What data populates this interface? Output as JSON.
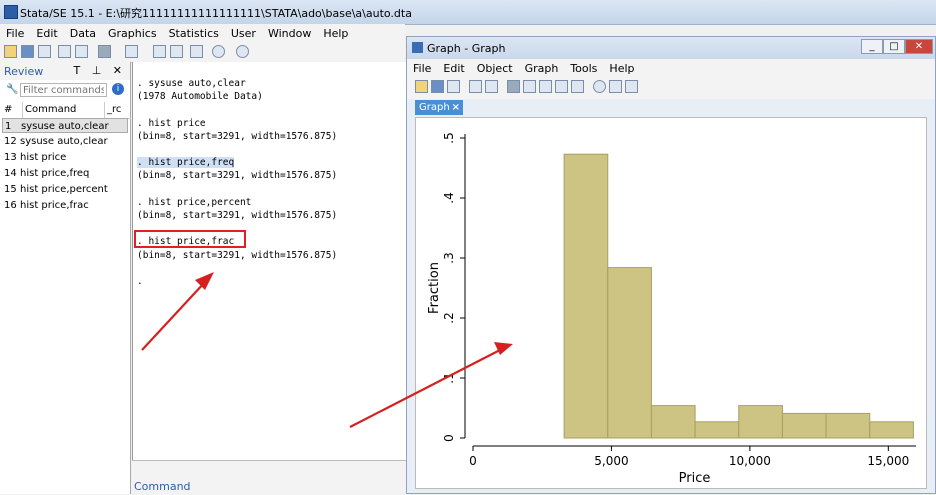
{
  "main_window": {
    "title": "Stata/SE 15.1 - E:\\研究11111111111111111\\STATA\\ado\\base\\a\\auto.dta"
  },
  "menubar": [
    "File",
    "Edit",
    "Data",
    "Graphics",
    "Statistics",
    "User",
    "Window",
    "Help"
  ],
  "review": {
    "title": "Review",
    "controls": "T ⊥ ✕",
    "filter_placeholder": "Filter commands here",
    "col_num": "#",
    "col_command": "Command",
    "col_rc": "_rc",
    "rows": [
      {
        "num": "1",
        "cmd": "sysuse auto,clear",
        "selected": true
      },
      {
        "num": "12",
        "cmd": "sysuse auto,clear",
        "selected": false
      },
      {
        "num": "13",
        "cmd": "hist price",
        "selected": false
      },
      {
        "num": "14",
        "cmd": "hist price,freq",
        "selected": false
      },
      {
        "num": "15",
        "cmd": "hist price,percent",
        "selected": false
      },
      {
        "num": "16",
        "cmd": "hist price,frac",
        "selected": false
      }
    ]
  },
  "results": {
    "lines": [
      {
        "text": ". sysuse auto,clear",
        "highlight": false
      },
      {
        "text": "(1978 Automobile Data)",
        "highlight": false
      },
      {
        "text": "",
        "highlight": false
      },
      {
        "text": ". hist price",
        "highlight": false
      },
      {
        "text": "(bin=8, start=3291, width=1576.875)",
        "highlight": false
      },
      {
        "text": "",
        "highlight": false
      },
      {
        "text": ". hist price,freq",
        "highlight": true
      },
      {
        "text": "(bin=8, start=3291, width=1576.875)",
        "highlight": false
      },
      {
        "text": "",
        "highlight": false
      },
      {
        "text": ". hist price,percent",
        "highlight": false
      },
      {
        "text": "(bin=8, start=3291, width=1576.875)",
        "highlight": false
      },
      {
        "text": "",
        "highlight": false
      },
      {
        "text": ". hist price,frac",
        "highlight": false
      },
      {
        "text": "(bin=8, start=3291, width=1576.875)",
        "highlight": false
      },
      {
        "text": "",
        "highlight": false
      },
      {
        "text": ".",
        "highlight": false
      }
    ]
  },
  "command_bar": {
    "label": "Command"
  },
  "graph_window": {
    "title": "Graph - Graph",
    "menu": [
      "File",
      "Edit",
      "Object",
      "Graph",
      "Tools",
      "Help"
    ],
    "tab_label": "Graph",
    "buttons": {
      "minimize": "_",
      "maximize": "□",
      "close": "✕"
    }
  },
  "colors": {
    "bar_fill": "#cdc383",
    "bar_stroke": "#a8a060",
    "arrow": "#d62020",
    "box": "#d22222"
  },
  "chart_data": {
    "type": "bar",
    "xlabel": "Price",
    "ylabel": "Fraction",
    "xlim": [
      0,
      16000
    ],
    "ylim": [
      0,
      0.5
    ],
    "x_ticks": [
      0,
      5000,
      10000,
      15000
    ],
    "x_tick_labels": [
      "0",
      "5,000",
      "10,000",
      "15,000"
    ],
    "y_ticks": [
      0,
      0.1,
      0.2,
      0.3,
      0.4,
      0.5
    ],
    "y_tick_labels": [
      "0",
      ".1",
      ".2",
      ".3",
      ".4",
      ".5"
    ],
    "bin_start": 3291,
    "bin_width": 1576.875,
    "values": [
      0.473,
      0.284,
      0.054,
      0.027,
      0.054,
      0.041,
      0.041,
      0.027
    ]
  }
}
